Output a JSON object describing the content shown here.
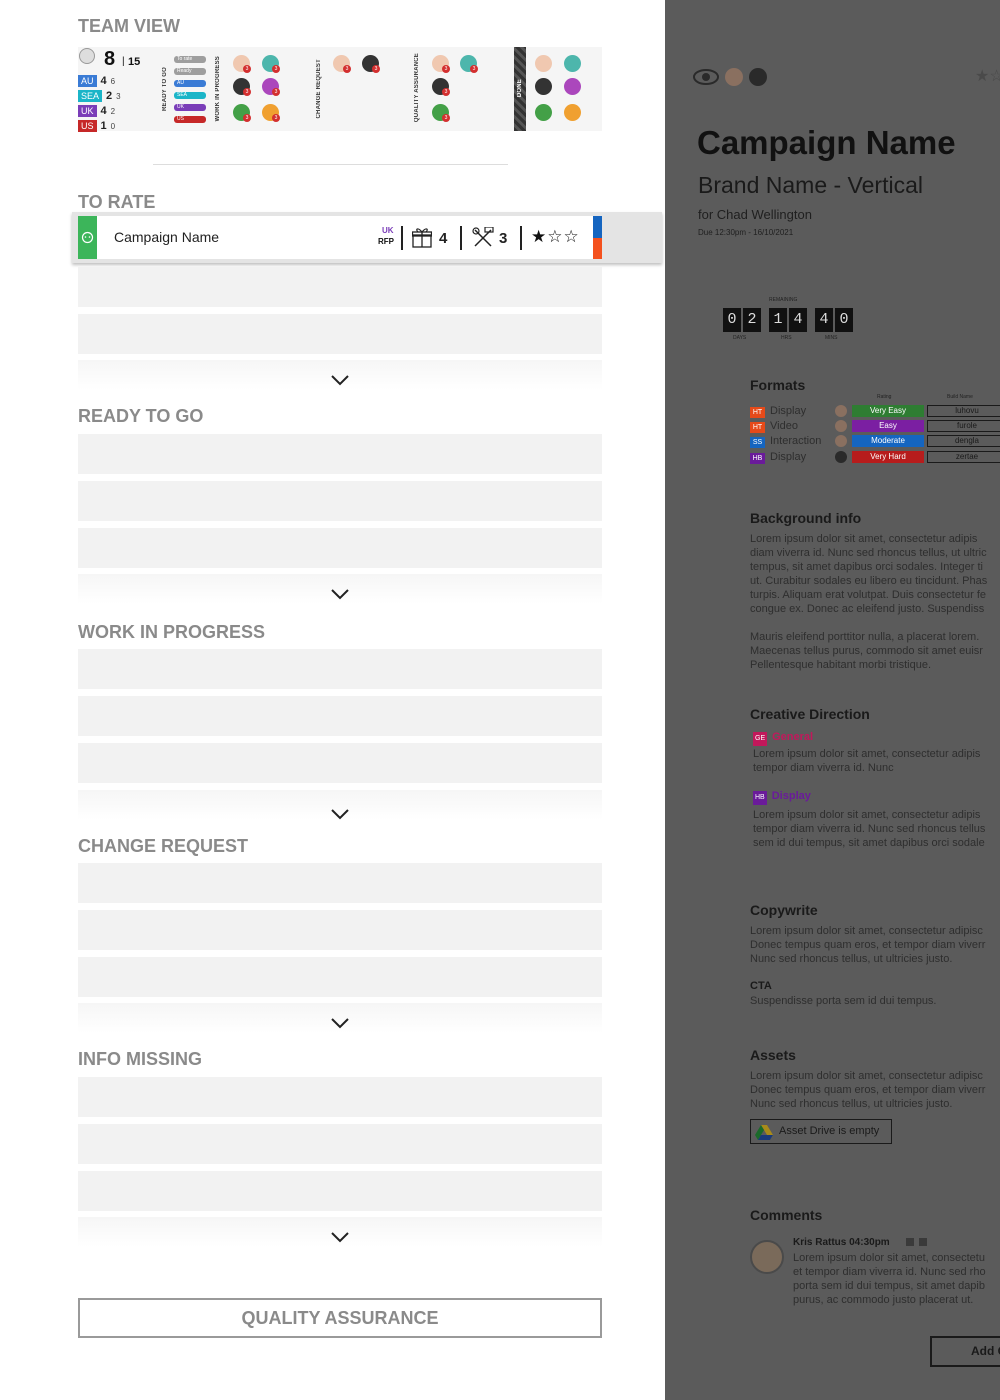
{
  "team_view": {
    "title": "TEAM VIEW",
    "total": "8",
    "total_of": "15",
    "regions": [
      {
        "code": "AU",
        "count": "4",
        "of": "6"
      },
      {
        "code": "SEA",
        "count": "2",
        "of": "3"
      },
      {
        "code": "UK",
        "count": "4",
        "of": "2"
      },
      {
        "code": "US",
        "count": "1",
        "of": "0"
      }
    ],
    "columns": [
      "READY TO GO",
      "WORK IN PROGRESS",
      "CHANGE REQUEST",
      "QUALITY ASSURANCE",
      "DONE"
    ],
    "pills": [
      "To rate",
      "Ready",
      "AU",
      "SEA",
      "UK",
      "US"
    ],
    "badge": "3"
  },
  "to_rate": {
    "title": "TO RATE",
    "campaign": {
      "name": "Campaign Name",
      "region": "UK",
      "type": "RFP",
      "gift_count": "4",
      "tools_count": "3",
      "stars": "★☆☆"
    }
  },
  "sections": [
    {
      "title": "READY TO GO"
    },
    {
      "title": "WORK IN PROGRESS"
    },
    {
      "title": "CHANGE REQUEST"
    },
    {
      "title": "INFO MISSING"
    }
  ],
  "qa_button": "QUALITY ASSURANCE",
  "detail": {
    "title": "Campaign Name",
    "subtitle": "Brand Name - Vertical",
    "for": "for Chad Wellington",
    "due": "Due 12:30pm - 16/10/2021",
    "countdown": {
      "label": "REMAINING",
      "days": [
        "0",
        "2"
      ],
      "hrs": [
        "1",
        "4"
      ],
      "mins": [
        "4",
        "0"
      ],
      "days_label": "DAYS",
      "hrs_label": "HRS",
      "mins_label": "MINS"
    },
    "formats": {
      "title": "Formats",
      "rating_header": "Rating",
      "build_header": "Build Name",
      "rows": [
        {
          "tag": "HT",
          "tag_color": "#e64a19",
          "name": "Display",
          "rating": "Very Easy",
          "rating_color": "#2e7d32",
          "build": "luhovu"
        },
        {
          "tag": "HT",
          "tag_color": "#e64a19",
          "name": "Video",
          "rating": "Easy",
          "rating_color": "#7b1fa2",
          "build": "furole"
        },
        {
          "tag": "SS",
          "tag_color": "#1565c0",
          "name": "Interaction",
          "rating": "Moderate",
          "rating_color": "#1565c0",
          "build": "dengla"
        },
        {
          "tag": "HB",
          "tag_color": "#6a1b9a",
          "name": "Display",
          "rating": "Very Hard",
          "rating_color": "#b71c1c",
          "build": "zertae"
        }
      ]
    },
    "background": {
      "title": "Background info",
      "lines": [
        "Lorem ipsum dolor sit amet, consectetur adipis",
        "diam viverra id. Nunc sed rhoncus tellus, ut ultric",
        "tempus, sit amet dapibus orci sodales. Integer ti",
        "ut. Curabitur sodales eu libero eu tincidunt. Phas",
        "turpis. Aliquam erat volutpat. Duis consectetur fe",
        "congue ex. Donec ac eleifend justo. Suspendiss"
      ],
      "lines2": [
        "Mauris eleifend porttitor nulla, a placerat lorem.",
        "Maecenas tellus purus, commodo sit amet euisr",
        "Pellentesque habitant morbi tristique."
      ]
    },
    "creative": {
      "title": "Creative Direction",
      "items": [
        {
          "tag": "GE",
          "tag_color": "#c2185b",
          "label": "General",
          "label_color": "#c2185b",
          "lines": [
            "Lorem ipsum dolor sit amet, consectetur adipis",
            "tempor diam viverra id. Nunc"
          ]
        },
        {
          "tag": "HB",
          "tag_color": "#6a1b9a",
          "label": "Display",
          "label_color": "#6a1b9a",
          "lines": [
            "Lorem ipsum dolor sit amet, consectetur adipis",
            "tempor diam viverra id. Nunc sed rhoncus tellus",
            "sem id dui tempus, sit amet dapibus orci sodale"
          ]
        }
      ]
    },
    "copywrite": {
      "title": "Copywrite",
      "lines": [
        "Lorem ipsum dolor sit amet, consectetur adipisc",
        "Donec tempus quam eros, et tempor diam viverr",
        "Nunc sed rhoncus tellus, ut ultricies justo."
      ],
      "cta_title": "CTA",
      "cta": "Suspendisse porta sem id dui tempus."
    },
    "assets": {
      "title": "Assets",
      "lines": [
        "Lorem ipsum dolor sit amet, consectetur adipisc",
        "Donec tempus quam eros, et tempor diam viverr",
        "Nunc sed rhoncus tellus, ut ultricies justo."
      ],
      "drive": "Asset Drive is empty"
    },
    "comments": {
      "title": "Comments",
      "author": "Kris Rattus 04:30pm",
      "lines": [
        "Lorem ipsum dolor sit amet, consectetu",
        "et tempor diam viverra id. Nunc sed rho",
        "porta sem id dui tempus, sit amet dapib",
        "purus, ac commodo justo placerat ut."
      ],
      "add_button": "Add C"
    }
  }
}
